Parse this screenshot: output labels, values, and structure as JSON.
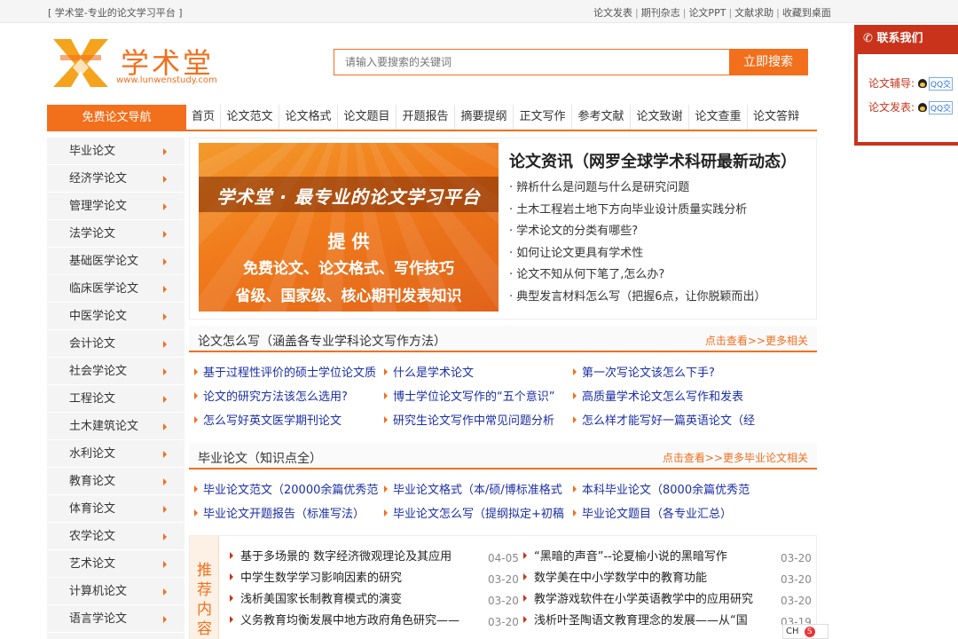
{
  "topbar": {
    "left": "[ 学术堂-专业的论文学习平台 ]",
    "links": [
      "论文发表",
      "期刊杂志",
      "论文PPT",
      "文献求助",
      "收藏到桌面"
    ]
  },
  "logo": {
    "name": "学术堂",
    "url": "www.lunwenstudy.com"
  },
  "search": {
    "placeholder": "请输入要搜索的关键词",
    "button": "立即搜索"
  },
  "contact": {
    "title": "联系我们",
    "rows": [
      {
        "label": "论文辅导:",
        "qq": "QQ交"
      },
      {
        "label": "论文发表:",
        "qq": "QQ交"
      }
    ]
  },
  "nav": {
    "first": "免费论文导航",
    "items": [
      "首页",
      "论文范文",
      "论文格式",
      "论文题目",
      "开题报告",
      "摘要提纲",
      "正文写作",
      "参考文献",
      "论文致谢",
      "论文查重",
      "论文答辩"
    ]
  },
  "sidebar": [
    "毕业论文",
    "经济学论文",
    "管理学论文",
    "法学论文",
    "基础医学论文",
    "临床医学论文",
    "中医学论文",
    "会计论文",
    "社会学论文",
    "工程论文",
    "土木建筑论文",
    "水利论文",
    "教育论文",
    "体育论文",
    "农学论文",
    "艺术论文",
    "计算机论文",
    "语言学论文"
  ],
  "banner": {
    "line1": "学术堂 · 最专业的论文学习平台",
    "line2": "提 供",
    "line3": "免费论文、论文格式、写作技巧",
    "line4": "省级、国家级、核心期刊发表知识"
  },
  "news": {
    "title": "论文资讯（网罗全球学术科研最新动态）",
    "items": [
      "辨析什么是问题与什么是研究问题",
      "土木工程岩土地下方向毕业设计质量实践分析",
      "学术论文的分类有哪些?",
      "如何让论文更具有学术性",
      "论文不知从何下笔了,怎么办?",
      "典型发言材料怎么写（把握6点，让你脱颖而出）"
    ]
  },
  "section1": {
    "title": "论文怎么写（涵盖各专业学科论文写作方法）",
    "more": "点击查看>>更多相关",
    "items": [
      "基于过程性评价的硕士学位论文质",
      "什么是学术论文",
      "第一次写论文该怎么下手?",
      "论文的研究方法该怎么选用?",
      "博士学位论文写作的“五个意识”",
      "高质量学术论文怎么写作和发表",
      "怎么写好英文医学期刊论文",
      "研究生论文写作中常见问题分析",
      "怎么样才能写好一篇英语论文（经"
    ]
  },
  "section2": {
    "title": "毕业论文（知识点全）",
    "more": "点击查看>>更多毕业论文相关",
    "items": [
      "毕业论文范文（20000余篇优秀范",
      "毕业论文格式（本/硕/博标准格式",
      "本科毕业论文（8000余篇优秀范",
      "毕业论文开题报告（标准写法）",
      "毕业论文怎么写（提纲拟定+初稿",
      "毕业论文题目（各专业汇总）"
    ]
  },
  "recommend": {
    "tag": [
      "推",
      "荐",
      "内",
      "容"
    ],
    "left": [
      {
        "title": "基于多场景的 数字经济微观理论及其应用",
        "date": "04-05"
      },
      {
        "title": "中学生数学学习影响因素的研究",
        "date": "03-20"
      },
      {
        "title": "浅析美国家长制教育模式的演变",
        "date": "03-20"
      },
      {
        "title": "义务教育均衡发展中地方政府角色研究——",
        "date": "03-20"
      }
    ],
    "right": [
      {
        "title": "“黑暗的声音”--论夏榆小说的黑暗写作",
        "date": "03-20"
      },
      {
        "title": "数学美在中小学数学中的教育功能",
        "date": "03-20"
      },
      {
        "title": "教学游戏软件在小学英语教学中的应用研究",
        "date": "03-20"
      },
      {
        "title": "浅析叶圣陶语文教育理念的发展——从“国",
        "date": "03-19"
      }
    ]
  },
  "ime": {
    "label": "CH"
  }
}
